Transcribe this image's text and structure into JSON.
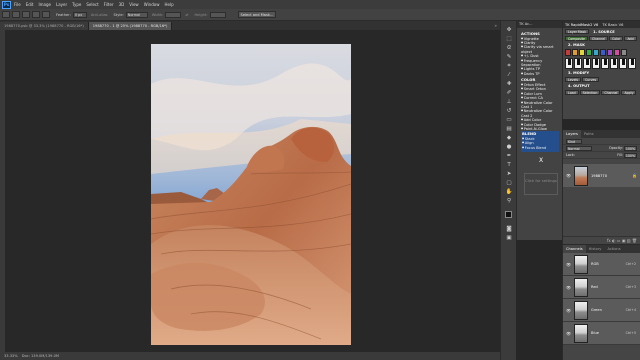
{
  "menubar": {
    "logo": "Ps",
    "items": [
      "File",
      "Edit",
      "Image",
      "Layer",
      "Type",
      "Select",
      "Filter",
      "3D",
      "View",
      "Window",
      "Help"
    ]
  },
  "options": {
    "feather_label": "Feather:",
    "feather_value": "0 px",
    "antialias_label": "Anti-alias",
    "style_label": "Style:",
    "style_value": "Normal",
    "width_label": "Width:",
    "height_label": "Height:",
    "select_mask": "Select and Mask..."
  },
  "tabs": [
    {
      "label": "1988770.psb @ 33.3% (1988770 - RGB/16*)",
      "active": false
    },
    {
      "label": "1988770 - 1 @ 25% (1988770 - RGB/16*)",
      "active": true
    }
  ],
  "tab_arrow": "»",
  "status": {
    "zoom": "33.33%",
    "doc": "Doc: 139.0M/139.0M"
  },
  "actions_panel": {
    "tab": "TK Ac...",
    "sections": [
      {
        "title": "ACTIONS",
        "items": [
          "Vignette",
          "Clarity",
          "Clarity via smart object",
          "+/- Dust",
          "Frequency Separation",
          "Lights TP",
          "Darks TP"
        ]
      },
      {
        "title": "COLOR",
        "items": [
          "Orton Effect",
          "Smart Orton",
          "Color Lum",
          "Correct CA",
          "Neutralize Color Cast 1",
          "Neutralize Color Cast 2",
          "Add Color",
          "Color Dodge",
          "Paint-N-Glow"
        ]
      }
    ],
    "blend": {
      "title": "BLEND",
      "items": [
        "Stack",
        "Align",
        "Focus Blend"
      ]
    },
    "close": "X",
    "settings": "Click for settings"
  },
  "tk_panel": {
    "tabs": [
      "TK RapidMask2 V6",
      "TK Basic V6"
    ],
    "layer_mask_label": "Layer Mask",
    "source_title": "1. SOURCE",
    "source_buttons": [
      "Composite",
      "Channel",
      "Color",
      "Add"
    ],
    "lum_label": "2. MASK",
    "modify_title": "3. MODIFY",
    "modify_buttons": [
      "Levels",
      "Curves"
    ],
    "output_title": "4. OUTPUT",
    "output_buttons": [
      "Load",
      "Selection",
      "Channel",
      "Apply"
    ],
    "swatch_colors": [
      "#c63a3a",
      "#e09a2e",
      "#e2d53a",
      "#3aa845",
      "#35a9c9",
      "#3a5cc9",
      "#9a4ac9",
      "#d04e9b",
      "#8a8a8a"
    ]
  },
  "layers_panel": {
    "tabs": [
      "Layers",
      "Paths"
    ],
    "kind_label": "Kind",
    "blend_mode": "Normal",
    "opacity_label": "Opacity:",
    "opacity_value": "100%",
    "lock_label": "Lock:",
    "fill_label": "Fill:",
    "fill_value": "100%",
    "layer_name": "1988770",
    "footer_icons": "fx ◐ ▭ ▣ ▥ 🗑"
  },
  "channels_panel": {
    "tabs": [
      "Channels",
      "History",
      "Actions"
    ],
    "channels": [
      {
        "name": "RGB",
        "shortcut": "Ctrl+2"
      },
      {
        "name": "Red",
        "shortcut": "Ctrl+3"
      },
      {
        "name": "Green",
        "shortcut": "Ctrl+4"
      },
      {
        "name": "Blue",
        "shortcut": "Ctrl+5"
      }
    ]
  }
}
